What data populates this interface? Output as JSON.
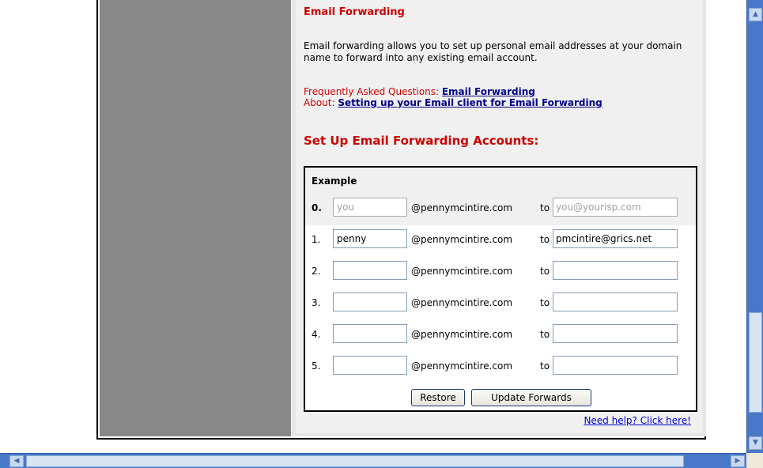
{
  "heading": "Email Forwarding",
  "intro": "Email forwarding allows you to set up personal email addresses at your domain name to forward into any existing email account.",
  "faq": {
    "label": "Frequently Asked Questions:",
    "link": "Email Forwarding"
  },
  "about": {
    "label": "About:",
    "link": "Setting up your Email client for Email Forwarding"
  },
  "setup_heading": "Set Up Email Forwarding Accounts:",
  "form": {
    "example_title": "Example",
    "domain": "@pennymcintire.com",
    "to_label": "to",
    "example_row": {
      "number": "0.",
      "user_placeholder": "you",
      "dest_placeholder": "you@yourisp.com"
    },
    "rows": [
      {
        "number": "1.",
        "user": "penny",
        "dest": "pmcintire@grics.net"
      },
      {
        "number": "2.",
        "user": "",
        "dest": ""
      },
      {
        "number": "3.",
        "user": "",
        "dest": ""
      },
      {
        "number": "4.",
        "user": "",
        "dest": ""
      },
      {
        "number": "5.",
        "user": "",
        "dest": ""
      }
    ],
    "restore_label": "Restore",
    "update_label": "Update Forwards"
  },
  "help_link": "Need help? Click here!",
  "scrollbars": {
    "up_icon": "scroll-up-arrow",
    "down_icon": "scroll-down-arrow",
    "left_icon": "scroll-left-arrow",
    "right_icon": "scroll-right-arrow"
  },
  "colors": {
    "heading_red": "#cc0000",
    "link_navy": "#00008b",
    "sidebar_gray": "#888888",
    "scrollbar_blue": "#4a78c8"
  }
}
